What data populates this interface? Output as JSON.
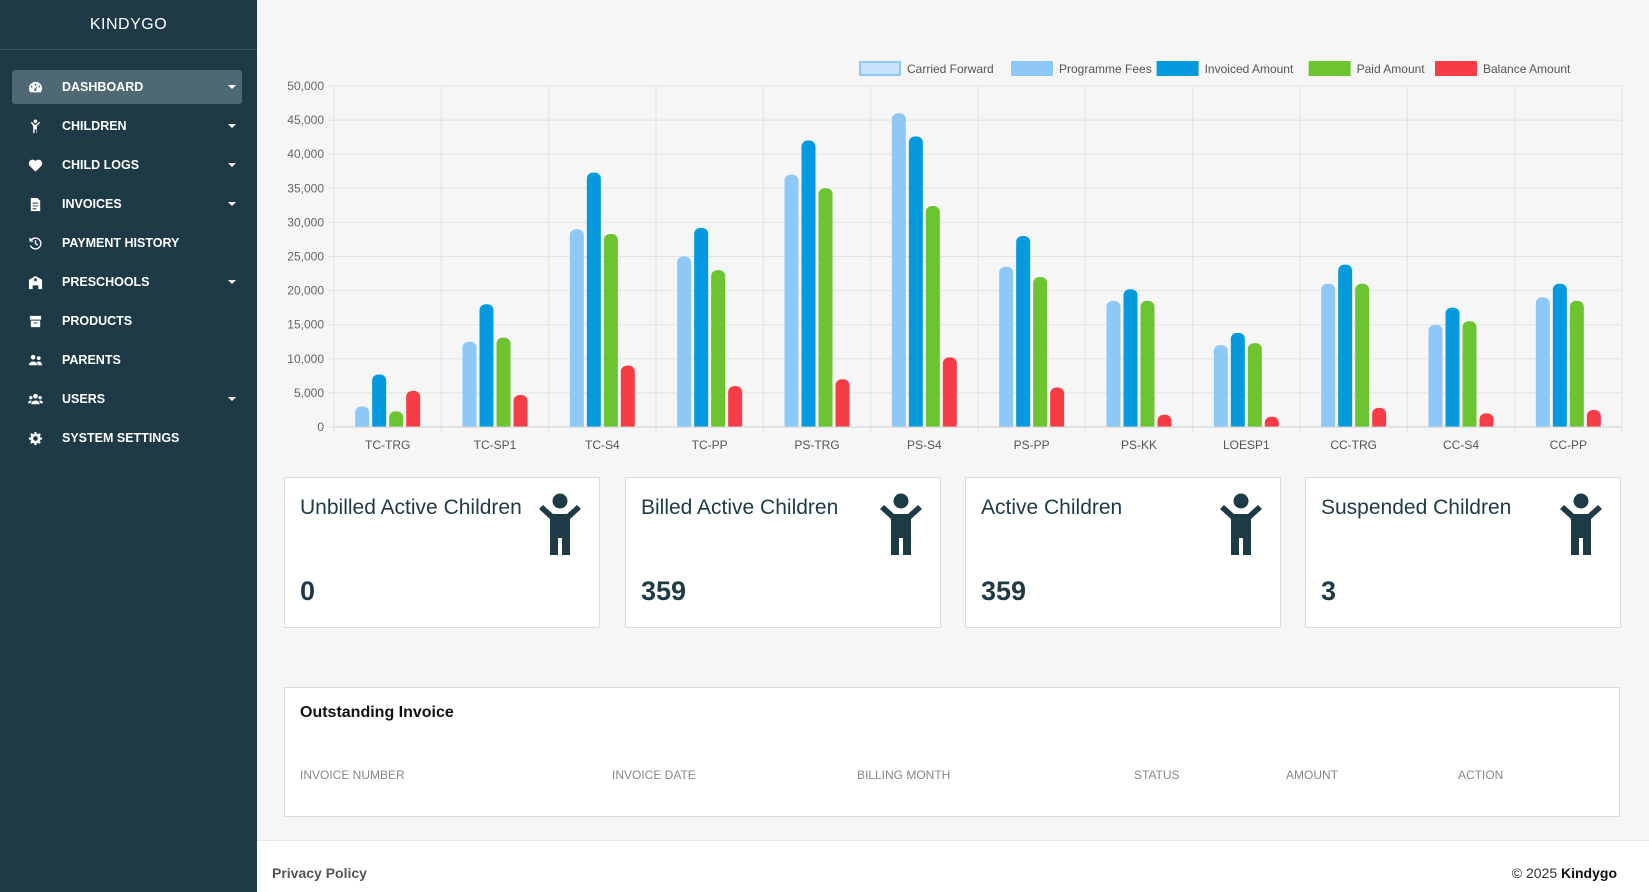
{
  "sidebar": {
    "brand": "KINDYGO",
    "items": [
      {
        "label": "DASHBOARD",
        "icon": "gauge-icon",
        "caret": true,
        "active": true
      },
      {
        "label": "CHILDREN",
        "icon": "child-icon",
        "caret": true
      },
      {
        "label": "CHILD LOGS",
        "icon": "heart-icon",
        "caret": true
      },
      {
        "label": "INVOICES",
        "icon": "invoice-icon",
        "caret": true
      },
      {
        "label": "PAYMENT HISTORY",
        "icon": "history-icon",
        "caret": false
      },
      {
        "label": "PRESCHOOLS",
        "icon": "school-icon",
        "caret": true
      },
      {
        "label": "PRODUCTS",
        "icon": "box-icon",
        "caret": false
      },
      {
        "label": "PARENTS",
        "icon": "parents-icon",
        "caret": false
      },
      {
        "label": "USERS",
        "icon": "users-icon",
        "caret": true
      },
      {
        "label": "SYSTEM SETTINGS",
        "icon": "gear-icon",
        "caret": false
      }
    ]
  },
  "chart_data": {
    "type": "bar",
    "categories": [
      "TC-TRG",
      "TC-SP1",
      "TC-S4",
      "TC-PP",
      "PS-TRG",
      "PS-S4",
      "PS-PP",
      "PS-KK",
      "LOESP1",
      "CC-TRG",
      "CC-S4",
      "CC-PP"
    ],
    "series": [
      {
        "name": "Carried Forward",
        "color": "#c6e2fb",
        "values": [
          0,
          0,
          0,
          0,
          0,
          0,
          0,
          0,
          0,
          0,
          0,
          0
        ]
      },
      {
        "name": "Programme Fees",
        "color": "#8ec8f7",
        "values": [
          3000,
          12500,
          29000,
          25000,
          37000,
          46000,
          23500,
          18500,
          12000,
          21000,
          15000,
          19000
        ]
      },
      {
        "name": "Invoiced Amount",
        "color": "#0599de",
        "values": [
          7700,
          18000,
          37300,
          29200,
          42000,
          42600,
          28000,
          20200,
          13800,
          23800,
          17500,
          21000
        ]
      },
      {
        "name": "Paid Amount",
        "color": "#6cc431",
        "values": [
          2300,
          13100,
          28300,
          23000,
          35000,
          32400,
          22000,
          18500,
          12300,
          21000,
          15500,
          18500
        ]
      },
      {
        "name": "Balance Amount",
        "color": "#f63d46",
        "values": [
          5300,
          4700,
          9000,
          6000,
          7000,
          10200,
          5800,
          1800,
          1500,
          2800,
          2000,
          2500
        ]
      }
    ],
    "ylim": [
      0,
      50000
    ],
    "yticks": [
      0,
      5000,
      10000,
      15000,
      20000,
      25000,
      30000,
      35000,
      40000,
      45000,
      50000
    ],
    "ytick_labels": [
      "0",
      "5,000",
      "10,000",
      "15,000",
      "20,000",
      "25,000",
      "30,000",
      "35,000",
      "40,000",
      "45,000",
      "50,000"
    ],
    "legend_placement": "top-center",
    "grid": true
  },
  "cards": [
    {
      "title": "Unbilled Active Children",
      "value": "0",
      "icon": "child-raised-arms-icon"
    },
    {
      "title": "Billed Active Children",
      "value": "359",
      "icon": "child-raised-arms-icon"
    },
    {
      "title": "Active Children",
      "value": "359",
      "icon": "child-raised-arms-icon"
    },
    {
      "title": "Suspended Children",
      "value": "3",
      "icon": "child-raised-arms-icon"
    }
  ],
  "outstanding": {
    "title": "Outstanding Invoice",
    "columns": [
      "INVOICE NUMBER",
      "INVOICE DATE",
      "BILLING MONTH",
      "STATUS",
      "AMOUNT",
      "ACTION"
    ]
  },
  "footer": {
    "privacy": "Privacy Policy",
    "copyright": "© 2025",
    "company": "Kindygo"
  }
}
